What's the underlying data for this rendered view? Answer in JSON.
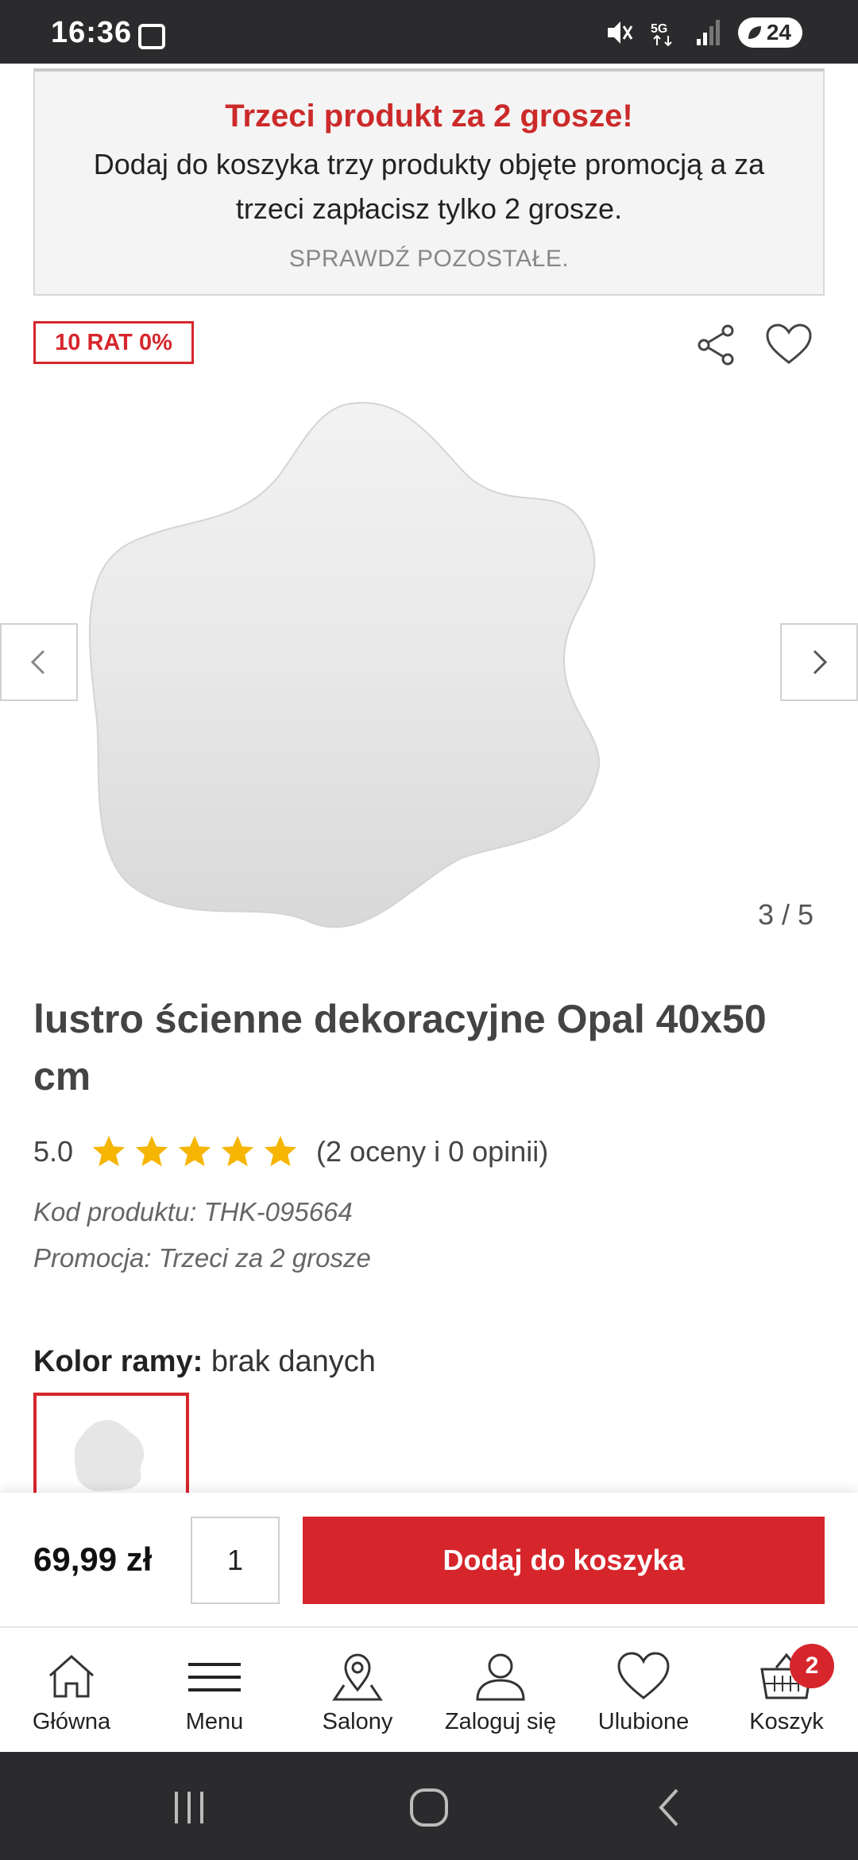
{
  "status_bar": {
    "time": "16:36",
    "battery": "24",
    "network": "5G"
  },
  "promo": {
    "title": "Trzeci produkt za 2 grosze!",
    "text": "Dodaj do koszyka trzy produkty objęte promocją a za trzeci zapłacisz tylko 2 grosze.",
    "link": "SPRAWDŹ POZOSTAŁE."
  },
  "badge": "10 RAT 0%",
  "gallery": {
    "counter": "3 / 5"
  },
  "product": {
    "title": "lustro ścienne dekoracyjne Opal 40x50 cm",
    "rating_value": "5.0",
    "rating_stars": 5,
    "rating_count": "(2 oceny i 0 opinii)",
    "code": "Kod produktu: THK-095664",
    "promotion": "Promocja: Trzeci za 2 grosze",
    "color_label": "Kolor ramy:",
    "color_value": "brak danych"
  },
  "cart_bar": {
    "price": "69,99 zł",
    "quantity": "1",
    "add_label": "Dodaj do koszyka"
  },
  "bottom_nav": {
    "items": [
      {
        "label": "Główna",
        "icon": "home-icon"
      },
      {
        "label": "Menu",
        "icon": "menu-icon"
      },
      {
        "label": "Salony",
        "icon": "map-pin-icon"
      },
      {
        "label": "Zaloguj się",
        "icon": "user-icon"
      },
      {
        "label": "Ulubione",
        "icon": "heart-icon"
      },
      {
        "label": "Koszyk",
        "icon": "basket-icon"
      }
    ],
    "cart_count": "2"
  },
  "colors": {
    "accent": "#d6262c",
    "promo_title": "#cc2a2a",
    "star": "#f5b500",
    "status_bg": "#2b2b2e"
  }
}
